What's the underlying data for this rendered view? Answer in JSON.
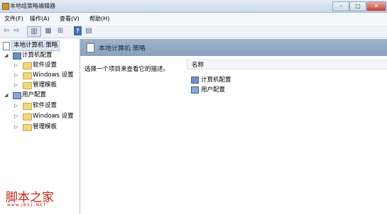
{
  "window": {
    "title": "本地组策略编辑器"
  },
  "menu": [
    "文件(F)",
    "操作(A)",
    "查看(V)",
    "帮助(H)"
  ],
  "toolbar": {
    "help_glyph": "?"
  },
  "tree": {
    "root": "本地计算机 策略",
    "computer": {
      "label": "计算机配置",
      "children": [
        "软件设置",
        "Windows 设置",
        "管理模板"
      ]
    },
    "user": {
      "label": "用户配置",
      "children": [
        "软件设置",
        "Windows 设置",
        "管理模板"
      ]
    }
  },
  "content": {
    "header": "本地计算机 策略",
    "description": "选择一个项目来查看它的描述。",
    "column": "名称",
    "items": [
      "计算机配置",
      "用户配置"
    ]
  },
  "watermark": {
    "title": "脚本之家",
    "url": "www.JB51.NET"
  }
}
